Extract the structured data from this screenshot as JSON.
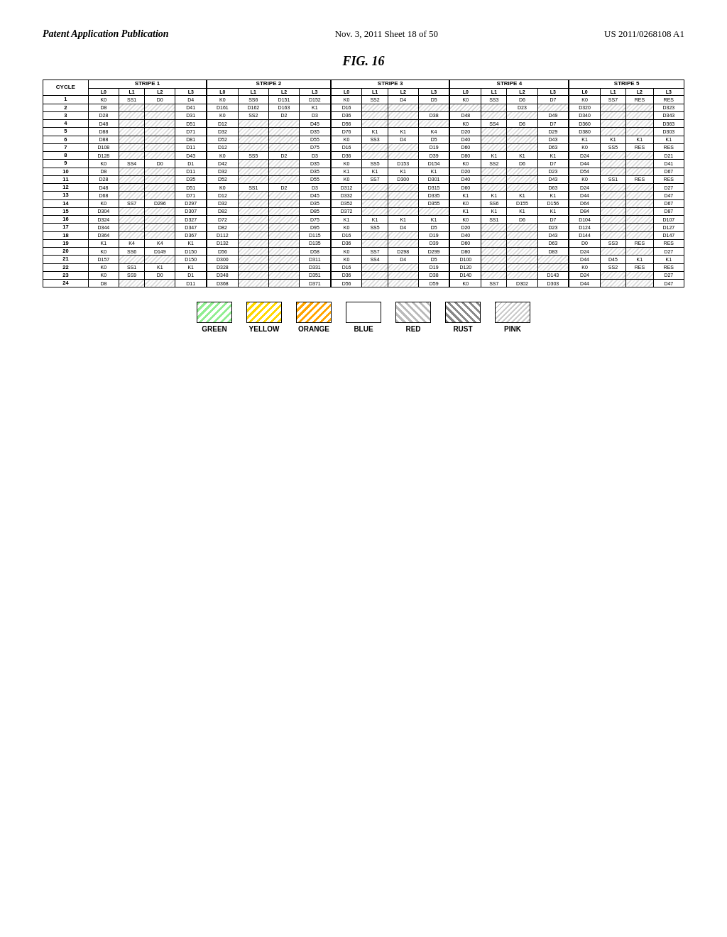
{
  "header": {
    "left": "Patent Application Publication",
    "center": "Nov. 3, 2011     Sheet 18 of 50",
    "right": "US 2011/0268108 A1"
  },
  "figure": {
    "title": "FIG. 16"
  },
  "table": {
    "stripes": [
      "STRIPE 1",
      "STRIPE 2",
      "STRIPE 3",
      "STRIPE 4",
      "STRIPE 5"
    ],
    "sub_cols": [
      "L0",
      "L1",
      "L2",
      "L3"
    ],
    "cycle_label": "CYCLE",
    "rows": [
      {
        "cycle": "1",
        "s1": [
          "K0",
          "SS1",
          "D0",
          "D4"
        ],
        "s2": [
          "K0",
          "SS6",
          "D151",
          "D152"
        ],
        "s3": [
          "K0",
          "SS2",
          "D4",
          "D5"
        ],
        "s4": [
          "K0",
          "SS3",
          "D6",
          "D7"
        ],
        "s5": [
          "K0",
          "SS7",
          "RES",
          "RES"
        ]
      },
      {
        "cycle": "2",
        "s1": [
          "D8",
          "",
          "",
          "D41"
        ],
        "s2": [
          "D161",
          "D162",
          "D163",
          "K1"
        ],
        "s3": [
          "D16",
          "",
          "",
          ""
        ],
        "s4": [
          "",
          "",
          "D23",
          ""
        ],
        "s5": [
          "D320",
          "",
          "",
          "D323"
        ]
      },
      {
        "cycle": "3",
        "s1": [
          "D28",
          "",
          "",
          "D31"
        ],
        "s2": [
          "K0",
          "SS2",
          "D2",
          "D3"
        ],
        "s3": [
          "D36",
          "",
          "",
          "D38"
        ],
        "s4": [
          "D48",
          "",
          "",
          "D49"
        ],
        "s5": [
          "D340",
          "",
          "",
          "D343"
        ]
      },
      {
        "cycle": "4",
        "s1": [
          "D48",
          "",
          "",
          "D51"
        ],
        "s2": [
          "D12",
          "",
          "",
          "D45"
        ],
        "s3": [
          "D56",
          "",
          "",
          ""
        ],
        "s4": [
          "K0",
          "SS4",
          "D6",
          "D7"
        ],
        "s5": [
          "D360",
          "",
          "",
          "D363"
        ]
      },
      {
        "cycle": "5",
        "s1": [
          "D88",
          "",
          "",
          "D71"
        ],
        "s2": [
          "D32",
          "",
          "",
          "D35"
        ],
        "s3": [
          "D76",
          "K1",
          "K1",
          "K4"
        ],
        "s4": [
          "D20",
          "",
          "",
          "D29"
        ],
        "s5": [
          "D380",
          "",
          "",
          "D303"
        ]
      },
      {
        "cycle": "6",
        "s1": [
          "D88",
          "",
          "",
          "D81"
        ],
        "s2": [
          "D52",
          "",
          "",
          "D55"
        ],
        "s3": [
          "K0",
          "SS3",
          "D4",
          "D5"
        ],
        "s4": [
          "D40",
          "",
          "",
          "D43"
        ],
        "s5": [
          "K1",
          "K1",
          "K1",
          "K1"
        ]
      },
      {
        "cycle": "7",
        "s1": [
          "D108",
          "",
          "",
          "D11"
        ],
        "s2": [
          "D12",
          "",
          "",
          "D75"
        ],
        "s3": [
          "D16",
          "",
          "",
          "D19"
        ],
        "s4": [
          "D60",
          "",
          "",
          "D63"
        ],
        "s5": [
          "K0",
          "SS5",
          "RES",
          "RES"
        ]
      },
      {
        "cycle": "8",
        "s1": [
          "D128",
          "",
          "",
          "D43"
        ],
        "s2": [
          "K0",
          "SS5",
          "D2",
          "D3"
        ],
        "s3": [
          "D36",
          "",
          "",
          "D39"
        ],
        "s4": [
          "D80",
          "K1",
          "K1",
          "K1"
        ],
        "s5": [
          "D24",
          "",
          "",
          "D21"
        ]
      },
      {
        "cycle": "9",
        "s1": [
          "K0",
          "SS4",
          "D0",
          "D1"
        ],
        "s2": [
          "D42",
          "",
          "",
          "D35"
        ],
        "s3": [
          "K0",
          "SS5",
          "D153",
          "D154"
        ],
        "s4": [
          "K0",
          "SS2",
          "D6",
          "D7"
        ],
        "s5": [
          "D44",
          "",
          "",
          "D41"
        ]
      },
      {
        "cycle": "10",
        "s1": [
          "D8",
          "",
          "",
          "D11"
        ],
        "s2": [
          "D32",
          "",
          "",
          "D35"
        ],
        "s3": [
          "K1",
          "K1",
          "K1",
          "K1"
        ],
        "s4": [
          "D20",
          "",
          "",
          "D23"
        ],
        "s5": [
          "D54",
          "",
          "",
          "D67"
        ]
      },
      {
        "cycle": "11",
        "s1": [
          "D28",
          "",
          "",
          "D35"
        ],
        "s2": [
          "D52",
          "",
          "",
          "D55"
        ],
        "s3": [
          "K0",
          "SS7",
          "D300",
          "D301"
        ],
        "s4": [
          "D40",
          "",
          "",
          "D43"
        ],
        "s5": [
          "K0",
          "SS1",
          "RES",
          "RES"
        ]
      },
      {
        "cycle": "12",
        "s1": [
          "D48",
          "",
          "",
          "D51"
        ],
        "s2": [
          "K0",
          "SS1",
          "D2",
          "D3"
        ],
        "s3": [
          "D312",
          "",
          "",
          "D315"
        ],
        "s4": [
          "D60",
          "",
          "",
          "D63"
        ],
        "s5": [
          "D24",
          "",
          "",
          "D27"
        ]
      },
      {
        "cycle": "13",
        "s1": [
          "D68",
          "",
          "",
          "D71"
        ],
        "s2": [
          "D12",
          "",
          "",
          "D45"
        ],
        "s3": [
          "D332",
          "",
          "",
          "D335"
        ],
        "s4": [
          "K1",
          "K1",
          "K1",
          "K1"
        ],
        "s5": [
          "D44",
          "",
          "",
          "D47"
        ]
      },
      {
        "cycle": "14",
        "s1": [
          "K0",
          "SS7",
          "D296",
          "D297"
        ],
        "s2": [
          "D32",
          "",
          "",
          "D35"
        ],
        "s3": [
          "D352",
          "",
          "",
          "D355"
        ],
        "s4": [
          "K0",
          "SS6",
          "D155",
          "D156"
        ],
        "s5": [
          "D64",
          "",
          "",
          "D67"
        ]
      },
      {
        "cycle": "15",
        "s1": [
          "D304",
          "",
          "",
          "D307"
        ],
        "s2": [
          "D82",
          "",
          "",
          "D85"
        ],
        "s3": [
          "D372",
          "",
          "",
          ""
        ],
        "s4": [
          "K1",
          "K1",
          "K1",
          "K1"
        ],
        "s5": [
          "D84",
          "",
          "",
          "D87"
        ]
      },
      {
        "cycle": "16",
        "s1": [
          "D324",
          "",
          "",
          "D327"
        ],
        "s2": [
          "D72",
          "",
          "",
          "D75"
        ],
        "s3": [
          "K1",
          "K1",
          "K1",
          "K1"
        ],
        "s4": [
          "K0",
          "SS1",
          "D6",
          "D7"
        ],
        "s5": [
          "D104",
          "",
          "",
          "D107"
        ]
      },
      {
        "cycle": "17",
        "s1": [
          "D344",
          "",
          "",
          "D347"
        ],
        "s2": [
          "D82",
          "",
          "",
          "D95"
        ],
        "s3": [
          "K0",
          "SS5",
          "D4",
          "D5"
        ],
        "s4": [
          "D20",
          "",
          "",
          "D23"
        ],
        "s5": [
          "D124",
          "",
          "",
          "D127"
        ]
      },
      {
        "cycle": "18",
        "s1": [
          "D364",
          "",
          "",
          "D367"
        ],
        "s2": [
          "D112",
          "",
          "",
          "D115"
        ],
        "s3": [
          "D16",
          "",
          "",
          "D19"
        ],
        "s4": [
          "D40",
          "",
          "",
          "D43"
        ],
        "s5": [
          "D144",
          "",
          "",
          "D147"
        ]
      },
      {
        "cycle": "19",
        "s1": [
          "K1",
          "K4",
          "K4",
          "K1"
        ],
        "s2": [
          "D132",
          "",
          "",
          "D135"
        ],
        "s3": [
          "D36",
          "",
          "",
          "D39"
        ],
        "s4": [
          "D60",
          "",
          "",
          "D63"
        ],
        "s5": [
          "D0",
          "SS3",
          "RES",
          "RES"
        ]
      },
      {
        "cycle": "20",
        "s1": [
          "K0",
          "SS6",
          "D149",
          "D150"
        ],
        "s2": [
          "D56",
          "",
          "",
          "D58"
        ],
        "s3": [
          "K0",
          "SS7",
          "D298",
          "D299"
        ],
        "s4": [
          "D80",
          "",
          "",
          "D83"
        ],
        "s5": [
          "D24",
          "",
          "",
          "D27"
        ]
      },
      {
        "cycle": "21",
        "s1": [
          "D157",
          "",
          "",
          "D150"
        ],
        "s2": [
          "D300",
          "",
          "",
          "D311"
        ],
        "s3": [
          "K0",
          "SS4",
          "D4",
          "D5"
        ],
        "s4": [
          "D100",
          "",
          "",
          ""
        ],
        "s5": [
          "D44",
          "D45",
          "K1",
          "K1"
        ]
      },
      {
        "cycle": "22",
        "s1": [
          "K0",
          "SS1",
          "K1",
          "K1"
        ],
        "s2": [
          "D328",
          "",
          "",
          "D331"
        ],
        "s3": [
          "D16",
          "",
          "",
          "D19"
        ],
        "s4": [
          "D120",
          "",
          "",
          ""
        ],
        "s5": [
          "K0",
          "SS2",
          "RES",
          "RES"
        ]
      },
      {
        "cycle": "23",
        "s1": [
          "K0",
          "SS9",
          "D0",
          "D1"
        ],
        "s2": [
          "D348",
          "",
          "",
          "D351"
        ],
        "s3": [
          "D36",
          "",
          "",
          "D38"
        ],
        "s4": [
          "D140",
          "",
          "",
          "D143"
        ],
        "s5": [
          "D24",
          "",
          "",
          "D27"
        ]
      },
      {
        "cycle": "24",
        "s1": [
          "D8",
          "",
          "",
          "D11"
        ],
        "s2": [
          "D368",
          "",
          "",
          "D371"
        ],
        "s3": [
          "D56",
          "",
          "",
          "D59"
        ],
        "s4": [
          "K0",
          "SS7",
          "D302",
          "D303"
        ],
        "s5": [
          "D44",
          "",
          "",
          "D47"
        ]
      }
    ]
  },
  "legend": {
    "items": [
      {
        "label": "GREEN",
        "style": "green"
      },
      {
        "label": "YELLOW",
        "style": "yellow"
      },
      {
        "label": "ORANGE",
        "style": "orange"
      },
      {
        "label": "BLUE",
        "style": "blue"
      },
      {
        "label": "RED",
        "style": "red"
      },
      {
        "label": "RUST",
        "style": "rust"
      },
      {
        "label": "PINK",
        "style": "pink"
      }
    ]
  }
}
